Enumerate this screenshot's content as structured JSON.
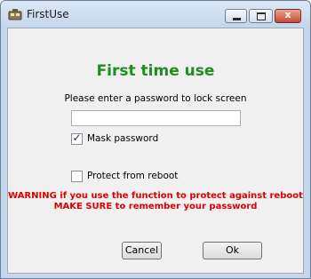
{
  "window": {
    "title": "FirstUse",
    "close_glyph": "x",
    "icons": {
      "app": "app-icon",
      "minimize": "minimize-icon",
      "maximize": "maximize-icon",
      "close": "close-icon"
    }
  },
  "main": {
    "heading": "First time use",
    "prompt": "Please enter a password to lock screen",
    "password": {
      "value": "",
      "placeholder": ""
    },
    "mask_password": {
      "label": "Mask password",
      "checked": true
    },
    "protect_reboot": {
      "label": "Protect from reboot",
      "checked": false
    },
    "warning_line1": "WARNING if you use the function to protect against reboot",
    "warning_line2": "MAKE SURE to remember your password"
  },
  "buttons": {
    "cancel": "Cancel",
    "ok": "Ok"
  },
  "colors": {
    "heading": "#1e8e1e",
    "warning": "#e00000",
    "title_bar": "#c5d7ec"
  }
}
